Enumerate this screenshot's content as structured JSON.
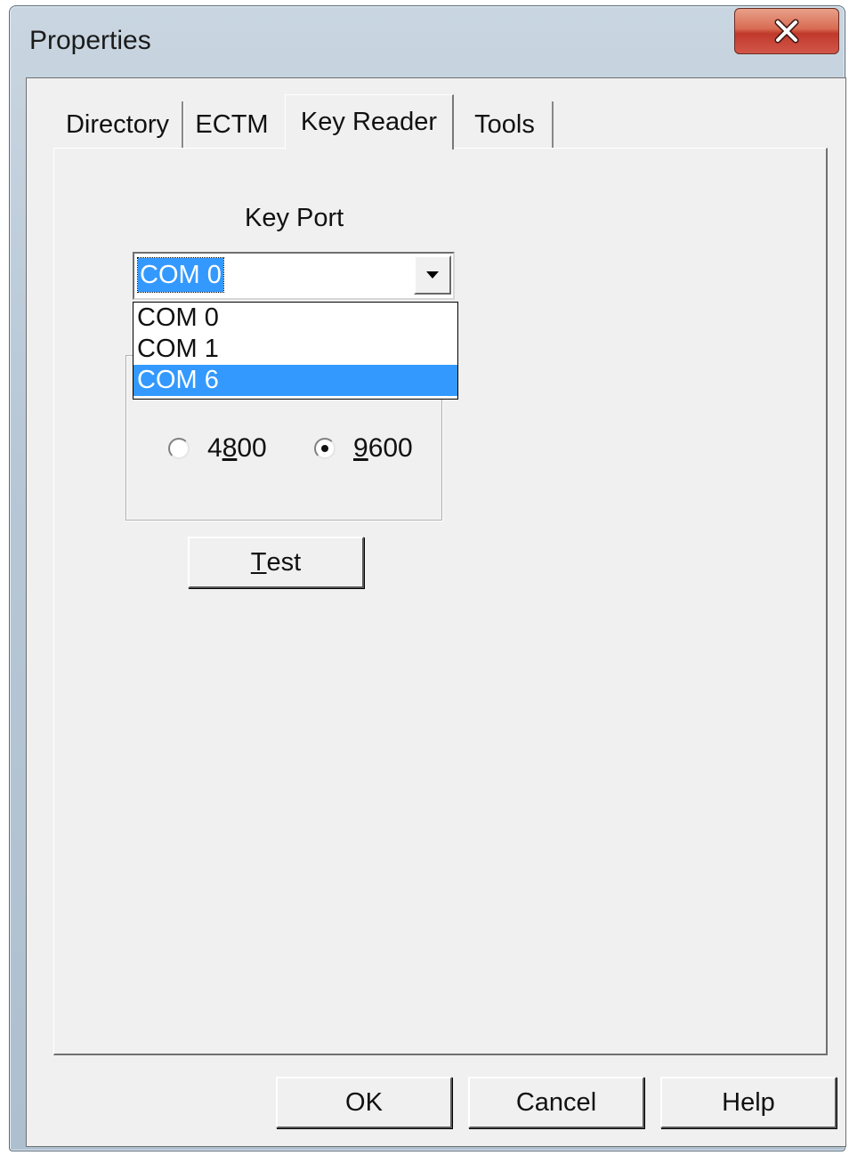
{
  "window": {
    "title": "Properties",
    "close_label": "X"
  },
  "tabs": [
    {
      "label": "Directory",
      "active": false
    },
    {
      "label": "ECTM",
      "active": false
    },
    {
      "label": "Key Reader",
      "active": true
    },
    {
      "label": "Tools",
      "active": false
    }
  ],
  "key_reader": {
    "key_port_label": "Key Port",
    "combo_value": "COM 0",
    "dropdown_options": [
      "COM 0",
      "COM 1",
      "COM 6"
    ],
    "highlighted_option": "COM 6",
    "baud_options": [
      {
        "label_pre": "4",
        "label_u": "8",
        "label_post": "00",
        "checked": false
      },
      {
        "label_pre": "",
        "label_u": "9",
        "label_post": "600",
        "checked": true
      }
    ],
    "test_button": {
      "u": "T",
      "rest": "est"
    }
  },
  "buttons": {
    "ok": "OK",
    "cancel": "Cancel",
    "help": "Help"
  }
}
